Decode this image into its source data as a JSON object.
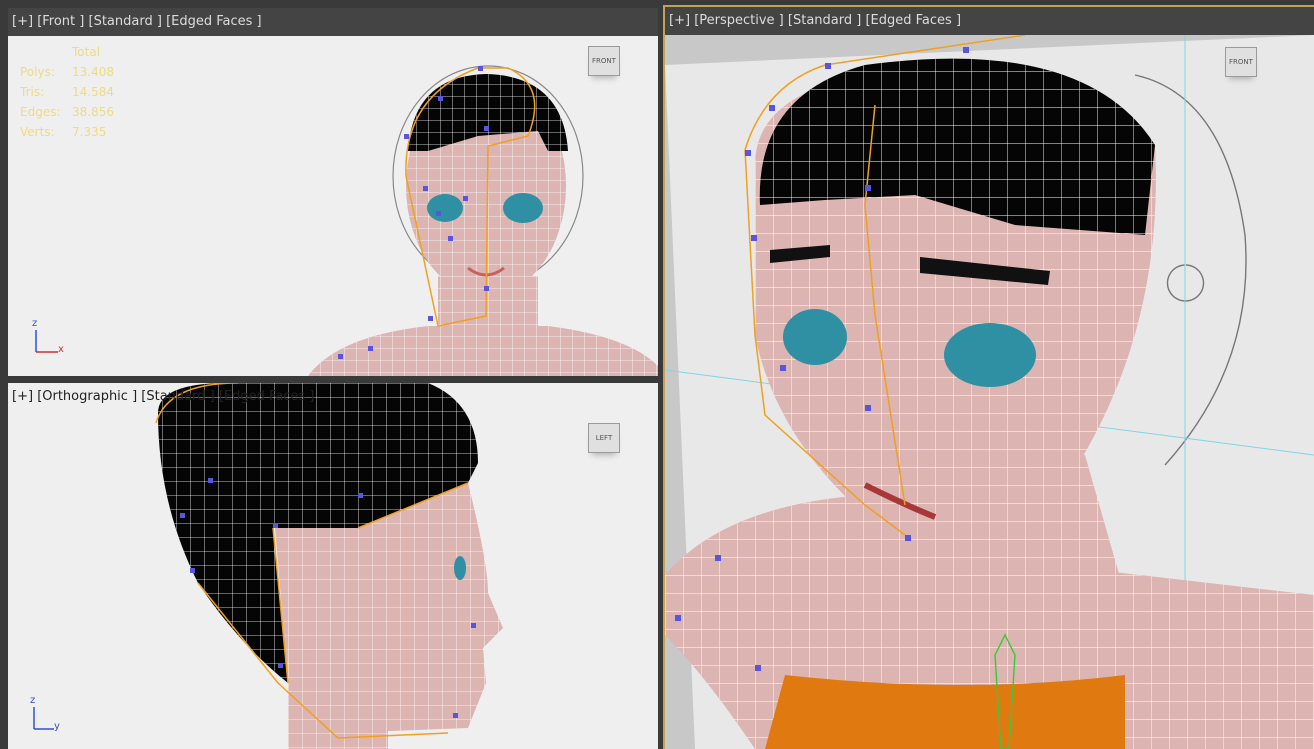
{
  "viewports": {
    "front": {
      "header": [
        "[+]",
        "[Front ]",
        "[Standard ]",
        "[Edged Faces ]"
      ],
      "viewcube_label": "FRONT",
      "stats": {
        "title": "Total",
        "rows": [
          {
            "label": "Polys:",
            "value": "13.408"
          },
          {
            "label": "Tris:",
            "value": "14.584"
          },
          {
            "label": "Edges:",
            "value": "38.856"
          },
          {
            "label": "Verts:",
            "value": "7.335"
          }
        ]
      },
      "axes": {
        "up": "z",
        "right": "x"
      }
    },
    "orthographic": {
      "header": [
        "[+]",
        "[Orthographic ]",
        "[Standard ]",
        "[Edged Faces ]"
      ],
      "viewcube_label": "LEFT",
      "axes": {
        "up": "z",
        "right": "y"
      }
    },
    "perspective": {
      "header": [
        "[+]",
        "[Perspective ]",
        "[Standard ]",
        "[Edged Faces ]"
      ],
      "viewcube_label": "FRONT"
    }
  },
  "colors": {
    "viewport_bg": "#efefef",
    "active_border": "#c8a24a",
    "skin": "#dcb4b1",
    "hair": "#050505",
    "wire_white": "#ffffff",
    "wire_orange": "#f0a020",
    "vertex": "#5a55e0",
    "eye": "#2f8fa3",
    "shirt": "#e07a10",
    "stats_text": "#eddb82"
  }
}
